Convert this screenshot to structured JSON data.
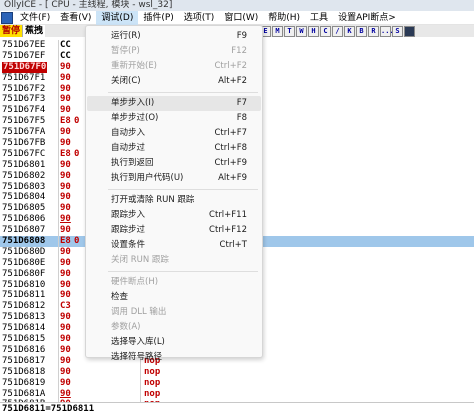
{
  "title": "OllyICE - [ CPU - 主线程, 模块 - wsl_32]",
  "menu": [
    "文件(F)",
    "查看(V)",
    "调试(D)",
    "插件(P)",
    "选项(T)",
    "窗口(W)",
    "帮助(H)",
    "工具",
    "设置API断点>"
  ],
  "toolbar": {
    "paused": "暂停",
    "mode": "蕉拽",
    "buttons": [
      "E",
      "M",
      "T",
      "W",
      "H",
      "C",
      "/",
      "K",
      "B",
      "R",
      "...",
      "S",
      ""
    ]
  },
  "rows": [
    {
      "addr": "751D67EE",
      "hex": "CC",
      "hexColor": "black",
      "mark": "",
      "instr": ""
    },
    {
      "addr": "751D67EF",
      "hex": "CC",
      "hexColor": "black",
      "mark": "",
      "instr": ""
    },
    {
      "addr": "751D67F0",
      "hex": "90",
      "hexColor": "red",
      "mark": "",
      "instr": "",
      "eip": true
    },
    {
      "addr": "751D67F1",
      "hex": "90",
      "hexColor": "red",
      "mark": "",
      "instr": ""
    },
    {
      "addr": "751D67F2",
      "hex": "90",
      "hexColor": "red",
      "mark": "",
      "instr": ""
    },
    {
      "addr": "751D67F3",
      "hex": "90",
      "hexColor": "red",
      "mark": "",
      "instr": ""
    },
    {
      "addr": "751D67F4",
      "hex": "90",
      "hexColor": "red",
      "mark": "",
      "instr": ""
    },
    {
      "addr": "751D67F5",
      "hex": "E8",
      "hexColor": "red",
      "mark": "0",
      "instr": ""
    },
    {
      "addr": "751D67FA",
      "hex": "90",
      "hexColor": "red",
      "mark": "",
      "instr": ""
    },
    {
      "addr": "751D67FB",
      "hex": "90",
      "hexColor": "red",
      "mark": "",
      "instr": ""
    },
    {
      "addr": "751D67FC",
      "hex": "E8",
      "hexColor": "red",
      "mark": "0",
      "instr": ""
    },
    {
      "addr": "751D6801",
      "hex": "90",
      "hexColor": "red",
      "mark": "",
      "instr": ""
    },
    {
      "addr": "751D6802",
      "hex": "90",
      "hexColor": "red",
      "mark": "",
      "instr": ""
    },
    {
      "addr": "751D6803",
      "hex": "90",
      "hexColor": "red",
      "mark": "",
      "instr": ""
    },
    {
      "addr": "751D6804",
      "hex": "90",
      "hexColor": "red",
      "mark": "",
      "instr": ""
    },
    {
      "addr": "751D6805",
      "hex": "90",
      "hexColor": "red",
      "mark": "",
      "instr": ""
    },
    {
      "addr": "751D6806",
      "hex": "90",
      "hexColor": "red",
      "mark": "",
      "instr": "",
      "underline": true
    },
    {
      "addr": "751D6807",
      "hex": "90",
      "hexColor": "red",
      "mark": "",
      "instr": ""
    },
    {
      "addr": "751D6808",
      "hex": "E8",
      "hexColor": "red",
      "mark": "0",
      "instr": "",
      "selected": true
    },
    {
      "addr": "751D680D",
      "hex": "90",
      "hexColor": "red",
      "mark": "",
      "instr": ""
    },
    {
      "addr": "751D680E",
      "hex": "90",
      "hexColor": "red",
      "mark": "",
      "instr": ""
    },
    {
      "addr": "751D680F",
      "hex": "90",
      "hexColor": "red",
      "mark": "",
      "instr": ""
    },
    {
      "addr": "751D6810",
      "hex": "90",
      "hexColor": "red",
      "mark": "",
      "instr": ""
    },
    {
      "addr": "751D6811",
      "hex": "90",
      "hexColor": "red",
      "mark": "",
      "instr": ""
    },
    {
      "addr": "751D6812",
      "hex": "C3",
      "hexColor": "red",
      "mark": "",
      "instr": ""
    },
    {
      "addr": "751D6813",
      "hex": "90",
      "hexColor": "red",
      "mark": "",
      "instr": ""
    },
    {
      "addr": "751D6814",
      "hex": "90",
      "hexColor": "red",
      "mark": "",
      "instr": ""
    },
    {
      "addr": "751D6815",
      "hex": "90",
      "hexColor": "red",
      "mark": "",
      "instr": ""
    },
    {
      "addr": "751D6816",
      "hex": "90",
      "hexColor": "red",
      "mark": "",
      "instr": ""
    },
    {
      "addr": "751D6817",
      "hex": "90",
      "hexColor": "red",
      "mark": "",
      "instr": "nop"
    },
    {
      "addr": "751D6818",
      "hex": "90",
      "hexColor": "red",
      "mark": "",
      "instr": "nop"
    },
    {
      "addr": "751D6819",
      "hex": "90",
      "hexColor": "red",
      "mark": "",
      "instr": "nop"
    },
    {
      "addr": "751D681A",
      "hex": "90",
      "hexColor": "red",
      "mark": "",
      "instr": "nop",
      "underline": true
    },
    {
      "addr": "751D681B",
      "hex": "90",
      "hexColor": "red",
      "mark": "",
      "instr": "nop"
    }
  ],
  "status": "751D6811=751D6811",
  "dropdown": [
    {
      "label": "运行(R)",
      "key": "F9"
    },
    {
      "label": "暂停(P)",
      "key": "F12",
      "disabled": true
    },
    {
      "label": "重新开始(E)",
      "key": "Ctrl+F2",
      "disabled": true
    },
    {
      "label": "关闭(C)",
      "key": "Alt+F2"
    },
    {
      "sep": true
    },
    {
      "label": "单步步入(I)",
      "key": "F7",
      "hl": true
    },
    {
      "label": "单步步过(O)",
      "key": "F8"
    },
    {
      "label": "自动步入",
      "key": "Ctrl+F7"
    },
    {
      "label": "自动步过",
      "key": "Ctrl+F8"
    },
    {
      "label": "执行到返回",
      "key": "Ctrl+F9"
    },
    {
      "label": "执行到用户代码(U)",
      "key": "Alt+F9"
    },
    {
      "sep": true
    },
    {
      "label": "打开或清除 RUN 跟踪",
      "key": ""
    },
    {
      "label": "跟踪步入",
      "key": "Ctrl+F11"
    },
    {
      "label": "跟踪步过",
      "key": "Ctrl+F12"
    },
    {
      "label": "设置条件",
      "key": "Ctrl+T"
    },
    {
      "label": "关闭 RUN 跟踪",
      "key": "",
      "disabled": true
    },
    {
      "sep": true
    },
    {
      "label": "硬件断点(H)",
      "key": "",
      "disabled": true
    },
    {
      "label": "检查",
      "key": ""
    },
    {
      "label": "调用 DLL 输出",
      "key": "",
      "disabled": true
    },
    {
      "label": "参数(A)",
      "key": "",
      "disabled": true
    },
    {
      "label": "选择导入库(L)",
      "key": ""
    },
    {
      "label": "选择符号路径",
      "key": ""
    }
  ]
}
